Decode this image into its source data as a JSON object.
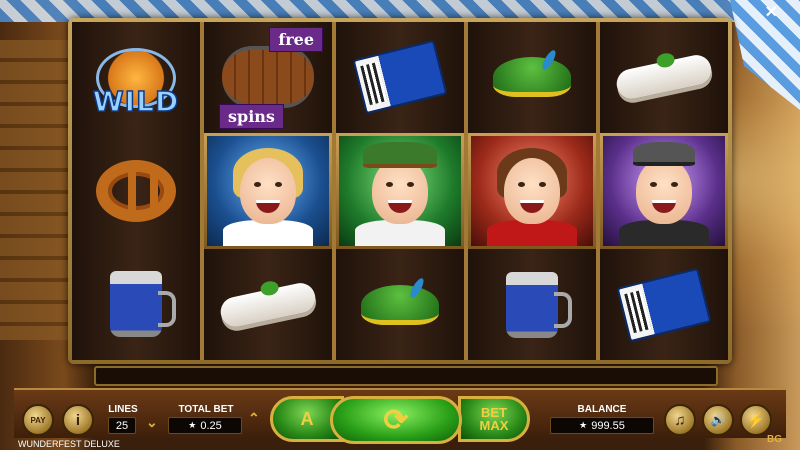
{
  "game": {
    "title": "WUNDERFEST DELUXE",
    "provider_tag": "BG",
    "close_glyph": "✕"
  },
  "reels": [
    [
      {
        "symbol": "wild",
        "label": "WILD"
      },
      {
        "symbol": "pretzel"
      },
      {
        "symbol": "beer-stein"
      }
    ],
    [
      {
        "symbol": "free-spins-barrel",
        "label_top": "free",
        "label_bottom": "spins"
      },
      {
        "symbol": "blonde-girl"
      },
      {
        "symbol": "sausage"
      }
    ],
    [
      {
        "symbol": "accordion"
      },
      {
        "symbol": "hat-man"
      },
      {
        "symbol": "alpine-hat"
      }
    ],
    [
      {
        "symbol": "alpine-hat"
      },
      {
        "symbol": "brunette-girl"
      },
      {
        "symbol": "beer-stein"
      }
    ],
    [
      {
        "symbol": "sausage"
      },
      {
        "symbol": "old-man"
      },
      {
        "symbol": "accordion"
      }
    ]
  ],
  "controls": {
    "paytable_label": "PAY",
    "info_glyph": "i",
    "lines_label": "LINES",
    "lines_value": "25",
    "total_bet_label": "TOTAL BET",
    "total_bet_value": "0.25",
    "auto_glyph": "A",
    "spin_glyph": "⟳",
    "bet_max_line1": "BET",
    "bet_max_line2": "MAX",
    "balance_label": "BALANCE",
    "balance_value": "999.55",
    "star_glyph": "★",
    "music_glyph": "♫",
    "sound_glyph": "🔊",
    "turbo_glyph": "⚡"
  }
}
